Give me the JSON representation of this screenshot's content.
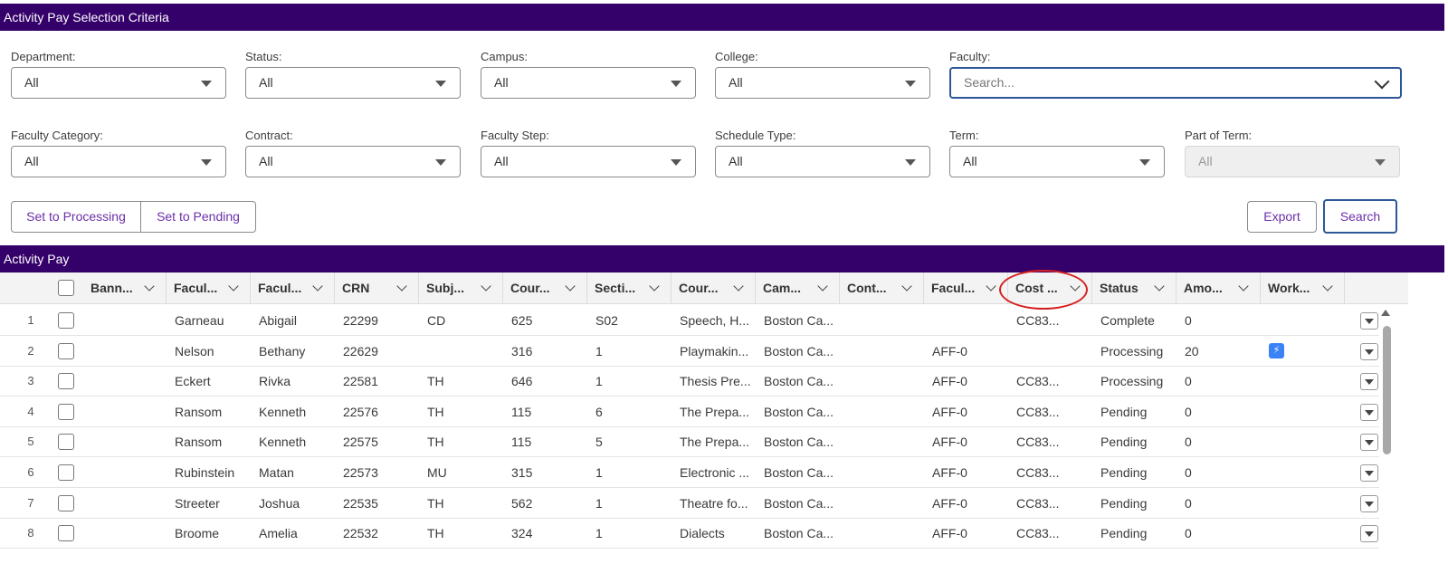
{
  "criteria": {
    "title": "Activity Pay Selection Criteria",
    "fields": [
      {
        "label": "Department:",
        "value": "All"
      },
      {
        "label": "Status:",
        "value": "All"
      },
      {
        "label": "Campus:",
        "value": "All"
      },
      {
        "label": "College:",
        "value": "All"
      },
      {
        "label": "Faculty:",
        "placeholder": "Search..."
      },
      {
        "label": "Faculty Category:",
        "value": "All"
      },
      {
        "label": "Contract:",
        "value": "All"
      },
      {
        "label": "Faculty Step:",
        "value": "All"
      },
      {
        "label": "Schedule Type:",
        "value": "All"
      },
      {
        "label": "Term:",
        "value": "All"
      },
      {
        "label": "Part of Term:",
        "value": "All"
      }
    ],
    "buttons": {
      "set_processing": "Set to Processing",
      "set_pending": "Set to Pending",
      "export": "Export",
      "search": "Search"
    }
  },
  "grid": {
    "title": "Activity Pay",
    "columns": [
      "Bann...",
      "Facul...",
      "Facul...",
      "CRN",
      "Subj...",
      "Cour...",
      "Secti...",
      "Cour...",
      "Cam...",
      "Cont...",
      "Facul...",
      "Cost ...",
      "Status",
      "Amo...",
      "Work..."
    ],
    "rows": [
      {
        "n": "1",
        "last": "Garneau",
        "first": "Abigail",
        "crn": "22299",
        "subj": "CD",
        "course": "625",
        "section": "S02",
        "title": "Speech, H...",
        "campus": "Boston Ca...",
        "contract": "",
        "faccat": "",
        "cost": "CC83...",
        "status": "Complete",
        "amount": "0",
        "work": false
      },
      {
        "n": "2",
        "last": "Nelson",
        "first": "Bethany",
        "crn": "22629",
        "subj": "",
        "course": "316",
        "section": "1",
        "title": "Playmakin...",
        "campus": "Boston Ca...",
        "contract": "",
        "faccat": "AFF-0",
        "cost": "",
        "status": "Processing",
        "amount": "20",
        "work": true
      },
      {
        "n": "3",
        "last": "Eckert",
        "first": "Rivka",
        "crn": "22581",
        "subj": "TH",
        "course": "646",
        "section": "1",
        "title": "Thesis Pre...",
        "campus": "Boston Ca...",
        "contract": "",
        "faccat": "AFF-0",
        "cost": "CC83...",
        "status": "Processing",
        "amount": "0",
        "work": false
      },
      {
        "n": "4",
        "last": "Ransom",
        "first": "Kenneth",
        "crn": "22576",
        "subj": "TH",
        "course": "115",
        "section": "6",
        "title": "The Prepa...",
        "campus": "Boston Ca...",
        "contract": "",
        "faccat": "AFF-0",
        "cost": "CC83...",
        "status": "Pending",
        "amount": "0",
        "work": false
      },
      {
        "n": "5",
        "last": "Ransom",
        "first": "Kenneth",
        "crn": "22575",
        "subj": "TH",
        "course": "115",
        "section": "5",
        "title": "The Prepa...",
        "campus": "Boston Ca...",
        "contract": "",
        "faccat": "AFF-0",
        "cost": "CC83...",
        "status": "Pending",
        "amount": "0",
        "work": false
      },
      {
        "n": "6",
        "last": "Rubinstein",
        "first": "Matan",
        "crn": "22573",
        "subj": "MU",
        "course": "315",
        "section": "1",
        "title": "Electronic ...",
        "campus": "Boston Ca...",
        "contract": "",
        "faccat": "AFF-0",
        "cost": "CC83...",
        "status": "Pending",
        "amount": "0",
        "work": false
      },
      {
        "n": "7",
        "last": "Streeter",
        "first": "Joshua",
        "crn": "22535",
        "subj": "TH",
        "course": "562",
        "section": "1",
        "title": "Theatre fo...",
        "campus": "Boston Ca...",
        "contract": "",
        "faccat": "AFF-0",
        "cost": "CC83...",
        "status": "Pending",
        "amount": "0",
        "work": false
      },
      {
        "n": "8",
        "last": "Broome",
        "first": "Amelia",
        "crn": "22532",
        "subj": "TH",
        "course": "324",
        "section": "1",
        "title": "Dialects",
        "campus": "Boston Ca...",
        "contract": "",
        "faccat": "AFF-0",
        "cost": "CC83...",
        "status": "Pending",
        "amount": "0",
        "work": false
      }
    ]
  },
  "colors": {
    "banner": "#34006a",
    "accent": "#6b2fa8",
    "focus": "#2d5796",
    "highlight_circle": "#d62020",
    "work_icon": "#3b82f6"
  }
}
